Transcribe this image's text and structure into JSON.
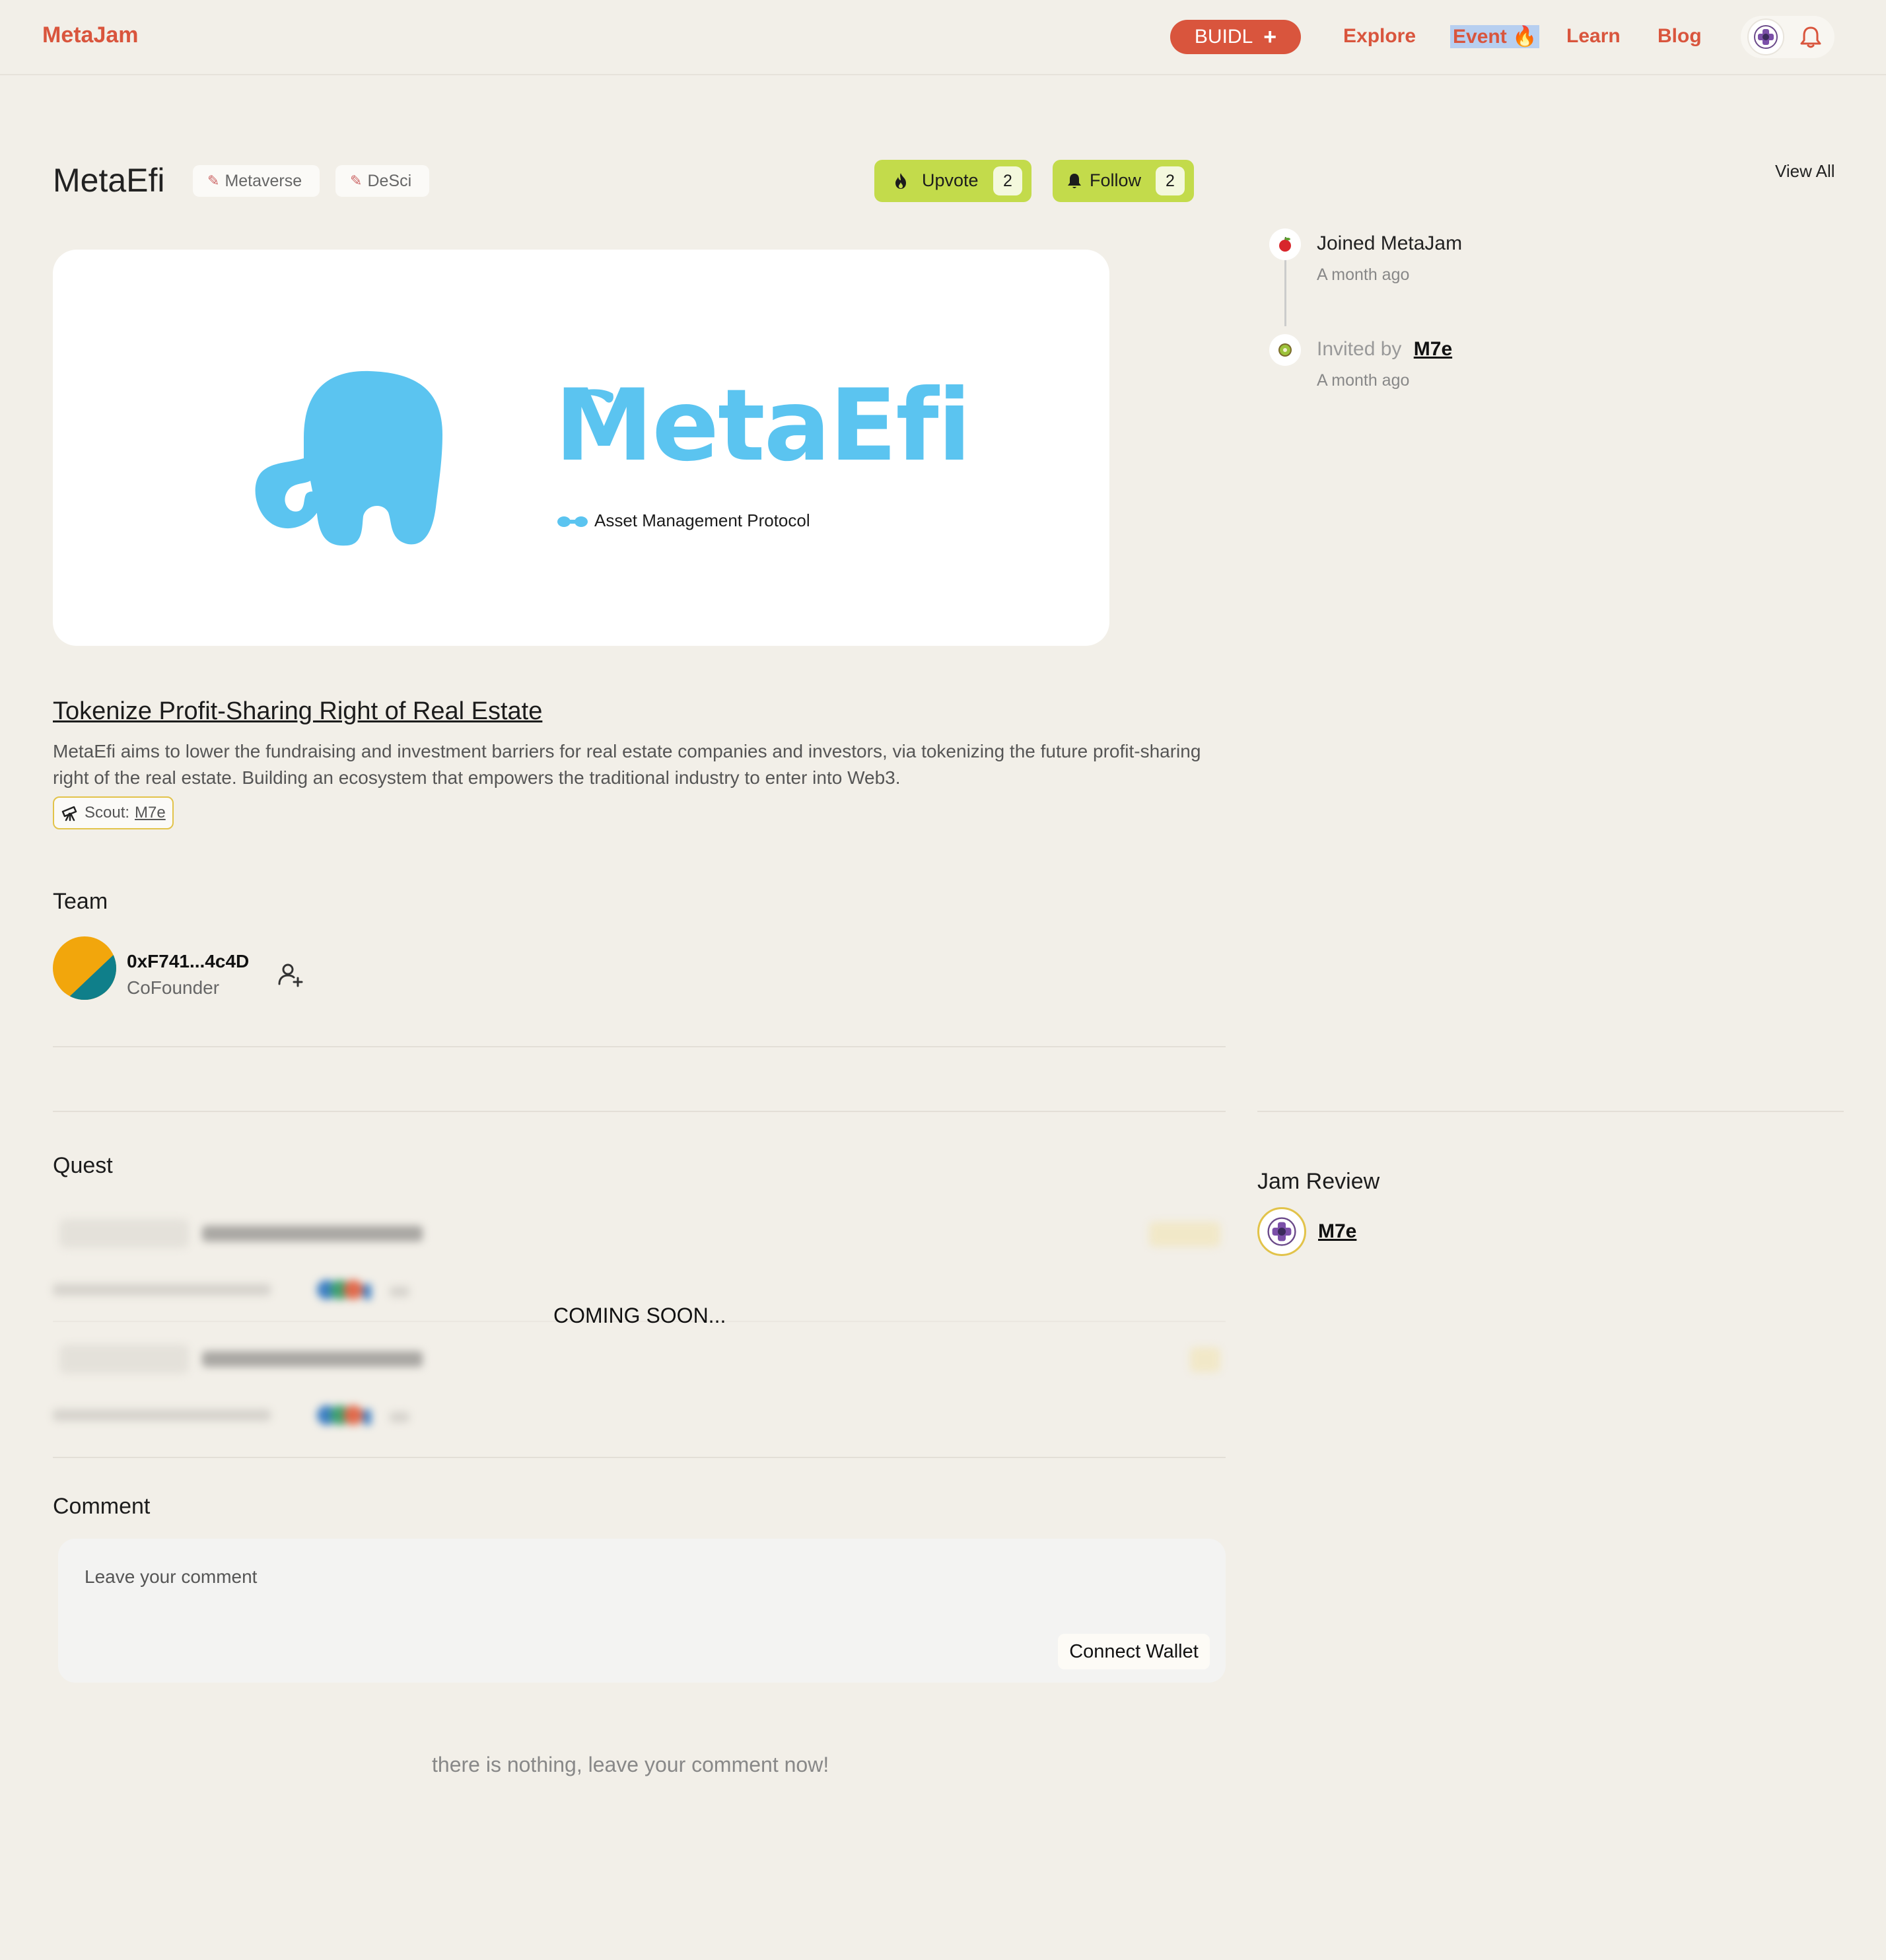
{
  "header": {
    "brand": "MetaJam",
    "buidl_label": "BUIDL",
    "buidl_icon": "plus-icon",
    "nav": {
      "explore": "Explore",
      "event": "Event",
      "event_emoji": "🔥",
      "learn": "Learn",
      "blog": "Blog"
    },
    "avatar_icon": "user-avatar-icon",
    "bell_icon": "bell-icon"
  },
  "project": {
    "name": "MetaEfi",
    "tags": [
      "Metaverse",
      "DeSci"
    ],
    "tag_icon": "tag-icon",
    "upvote": {
      "label": "Upvote",
      "count": "2",
      "icon": "fire-icon"
    },
    "follow": {
      "label": "Follow",
      "count": "2",
      "icon": "bell-icon"
    },
    "banner": {
      "logo_text": "MetaEfi",
      "logo_subtitle": "Asset Management Protocol",
      "logo_color": "#5bc4f0"
    },
    "headline": "Tokenize Profit-Sharing Right of Real Estate",
    "description": "MetaEfi aims to lower the fundraising and investment barriers for real estate companies and investors, via tokenizing the future profit-sharing right of the real estate. Building an ecosystem that empowers the traditional industry to enter into Web3.",
    "scout": {
      "prefix": "Scout:",
      "name": "M7e",
      "icon": "telescope-icon"
    }
  },
  "team": {
    "title": "Team",
    "members": [
      {
        "address": "0xF741...4c4D",
        "role": "CoFounder"
      }
    ],
    "add_icon": "add-user-icon"
  },
  "quest": {
    "title": "Quest",
    "overlay": "COMING SOON..."
  },
  "comment": {
    "title": "Comment",
    "placeholder": "Leave your comment",
    "connect_label": "Connect Wallet",
    "empty": "there is nothing, leave your comment now!"
  },
  "sidebar": {
    "view_all": "View All",
    "timeline": [
      {
        "text": "Joined MetaJam",
        "time": "A month ago",
        "icon": "apple-icon"
      },
      {
        "prefix": "Invited by",
        "link": "M7e",
        "time": "A month ago",
        "icon": "kiwi-icon"
      }
    ],
    "review": {
      "title": "Jam Review",
      "name": "M7e"
    }
  },
  "colors": {
    "accent": "#d9553d",
    "lime": "#c3db4b",
    "background": "#f2efe8",
    "scout_border": "#e2c34a"
  }
}
